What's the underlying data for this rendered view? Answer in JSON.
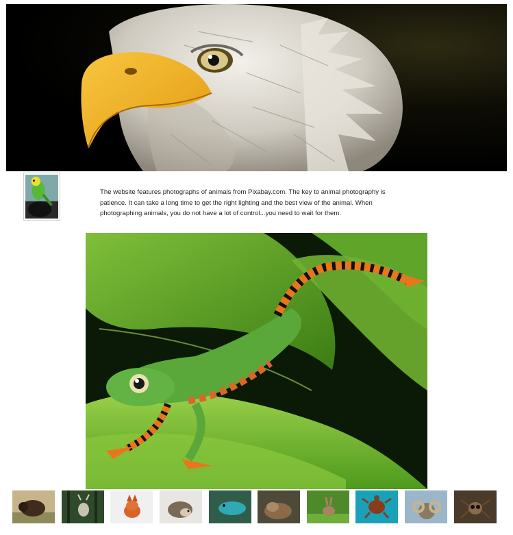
{
  "intro": {
    "text": "The website features photographs of animals from Pixabay.com. The key to animal photography is patience. It can take a long time to get the right lighting and the best view of the animal. When photographing animals, you do not have a lot of control...you need to wait for them."
  },
  "hero": {
    "subject": "bald eagle"
  },
  "avatar": {
    "subject": "parakeet"
  },
  "feature": {
    "subject": "tree frog"
  },
  "gallery": [
    "bison",
    "deer",
    "fox",
    "hedgehog",
    "lizard",
    "otter",
    "rabbit",
    "turtle",
    "ram",
    "spider"
  ]
}
